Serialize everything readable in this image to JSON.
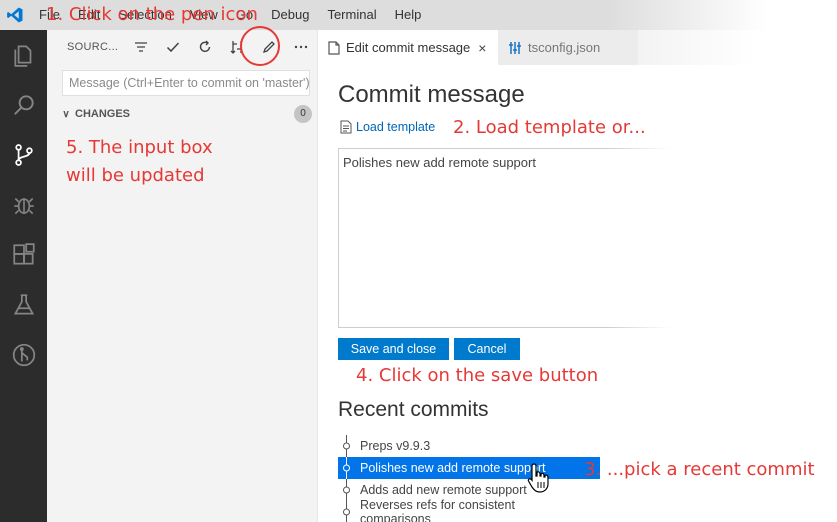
{
  "menu": {
    "items": [
      "File",
      "Edit",
      "Selection",
      "View",
      "Go",
      "Debug",
      "Terminal",
      "Help"
    ]
  },
  "activity": {
    "icons": [
      "explorer-icon",
      "search-icon",
      "source-control-icon",
      "debug-icon",
      "extensions-icon",
      "test-flask-icon",
      "git-graph-icon"
    ]
  },
  "sidebar": {
    "title": "SOURC...",
    "input_placeholder": "Message (Ctrl+Enter to commit on 'master')",
    "changes_label": "CHANGES",
    "changes_count": "0"
  },
  "tabs": [
    {
      "label": "Edit commit message",
      "close": "×"
    },
    {
      "label": "tsconfig.json"
    }
  ],
  "editor": {
    "heading": "Commit message",
    "load_template": "Load template",
    "message_text": "Polishes new add remote support",
    "save_button": "Save and close",
    "cancel_button": "Cancel",
    "recent_heading": "Recent commits",
    "commits": [
      "Preps v9.9.3",
      "Polishes new add remote support",
      "Adds add new remote support",
      "Reverses refs for consistent comparisons"
    ],
    "selected_commit_index": 1
  },
  "annotations": {
    "step1": "1. Click on the pen icon",
    "step2": "2. Load template or...",
    "step3": "3. ...pick a recent commit",
    "step4": "4. Click on the save button",
    "step5_line1": "5. The input box",
    "step5_line2": "will be updated"
  },
  "colors": {
    "accent": "#007acc",
    "annotation": "#e53935",
    "selected_row": "#0074e8",
    "activitybar": "#2c2c2c"
  }
}
